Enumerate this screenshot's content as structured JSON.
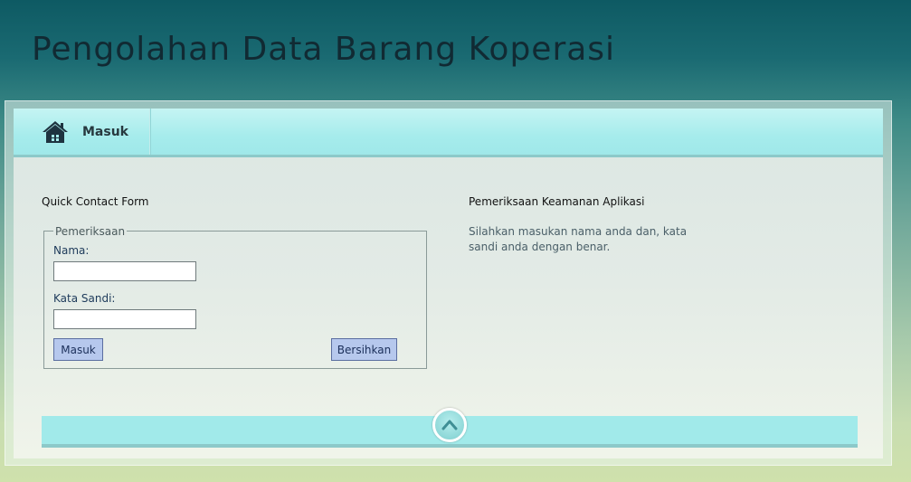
{
  "page": {
    "title": "Pengolahan Data Barang Koperasi"
  },
  "nav": {
    "items": [
      {
        "label": "Masuk",
        "icon": "home-icon"
      }
    ]
  },
  "form_section": {
    "heading": "Quick Contact Form",
    "fieldset_legend": "Pemeriksaan",
    "fields": [
      {
        "label": "Nama:",
        "value": ""
      },
      {
        "label": "Kata Sandi:",
        "value": ""
      }
    ],
    "buttons": {
      "submit_label": "Masuk",
      "clear_label": "Bersihkan"
    }
  },
  "info_section": {
    "heading": "Pemeriksaan Keamanan Aplikasi",
    "text": "Silahkan masukan nama anda dan, kata sandi anda dengan benar."
  },
  "footer": {
    "scroll_top_icon": "chevron-up-icon"
  },
  "colors": {
    "nav_background": "#a6ecec",
    "button_background": "#b6c8ed",
    "title_text": "#112a33"
  }
}
